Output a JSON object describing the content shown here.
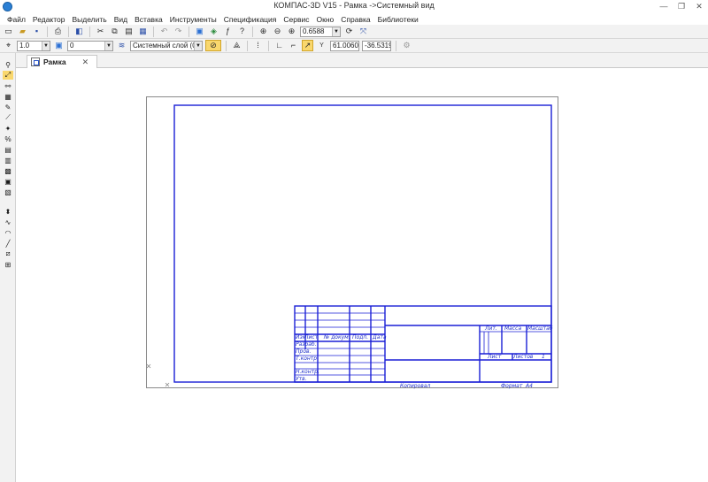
{
  "window": {
    "title": "КОМПАС-3D V15 - Рамка ->Системный вид",
    "controls": [
      "—",
      "❐",
      "✕"
    ]
  },
  "menu": {
    "items": [
      "Файл",
      "Редактор",
      "Выделить",
      "Вид",
      "Вставка",
      "Инструменты",
      "Спецификация",
      "Сервис",
      "Окно",
      "Справка",
      "Библиотеки"
    ]
  },
  "toolbar_standard": {
    "zoom_value": "0.6588"
  },
  "toolbar_properties": {
    "step_value": "1.0",
    "layer_number": "0",
    "layer_name": "Системный слой (0)",
    "coord_x": "61.0060",
    "coord_y": "-36.5319",
    "y_axis_label": "Y",
    "x_axis_label": "X"
  },
  "document_tab": {
    "label": "Рамка",
    "close": "✕"
  },
  "title_block": {
    "col_change": "Изм",
    "col_sheet": "Лист",
    "col_doc_no": "№ докум.",
    "col_sign": "Подп.",
    "col_date": "Дата",
    "row_developed": "Разраб.",
    "row_checked": "Пров.",
    "row_tcontrol": "Т.контр.",
    "row_ncontrol": "Н.контр.",
    "row_approved": "Утв.",
    "lit": "Лит.",
    "mass": "Масса",
    "scale": "Масштаб",
    "sheet": "Лист",
    "sheets": "Листов",
    "sheets_count": "1",
    "copied": "Копировал",
    "format": "Формат",
    "format_value": "А4"
  },
  "colors": {
    "frame": "#1a1fd6",
    "sheet_border": "#8a8a8a",
    "active_button": "#f9d76d"
  }
}
